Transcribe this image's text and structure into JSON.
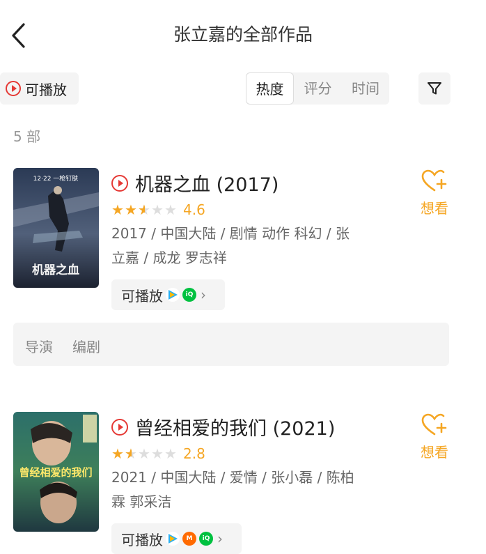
{
  "header": {
    "title": "张立嘉的全部作品",
    "back_icon": "chevron-left-icon"
  },
  "filters": {
    "playable_label": "可播放",
    "sort_options": [
      "热度",
      "评分",
      "时间"
    ],
    "active_sort": "热度",
    "filter_icon": "funnel-icon"
  },
  "count_label": "5 部",
  "movies": [
    {
      "title": "机器之血 (2017)",
      "rating": 4.6,
      "stars_filled": 2.5,
      "meta_line1": "2017 / 中国大陆 / 剧情 动作 科幻 / 张",
      "meta_line2": "立嘉 / 成龙 罗志祥",
      "playable_label": "可播放",
      "platforms": [
        "tencent-video",
        "iqiyi"
      ],
      "poster_text": "机器之血",
      "poster_date": "12·22 一枪钉肤",
      "want_label": "想看",
      "crew": [
        "导演",
        "编剧"
      ]
    },
    {
      "title": "曾经相爱的我们 (2021)",
      "rating": 2.8,
      "stars_filled": 1.5,
      "meta_line1": "2021 / 中国大陆 / 爱情 / 张小磊 / 陈柏",
      "meta_line2": "霖 郭采洁",
      "playable_label": "可播放",
      "platforms": [
        "tencent-video",
        "mango-tv",
        "iqiyi"
      ],
      "poster_text": "曾经相爱的我们",
      "want_label": "想看"
    }
  ],
  "colors": {
    "accent": "#f5a623",
    "play_red": "#e53935",
    "bg_chip": "#f4f4f4"
  }
}
